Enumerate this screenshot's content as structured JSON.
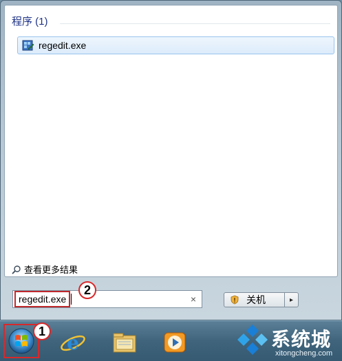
{
  "results": {
    "group_header": "程序 (1)",
    "items": [
      {
        "label": "regedit.exe",
        "icon": "regedit-icon"
      }
    ],
    "see_more": "查看更多结果"
  },
  "search": {
    "value": "regedit.exe",
    "clear_glyph": "×"
  },
  "shutdown": {
    "label": "关机",
    "arrow_glyph": "▸"
  },
  "callouts": {
    "start": "1",
    "search": "2"
  },
  "taskbar": {
    "icons": [
      "start-orb-icon",
      "ie-icon",
      "explorer-folder-icon",
      "media-player-icon"
    ]
  },
  "watermark": {
    "title": "系统城",
    "subtitle": "xitongcheng.com"
  }
}
